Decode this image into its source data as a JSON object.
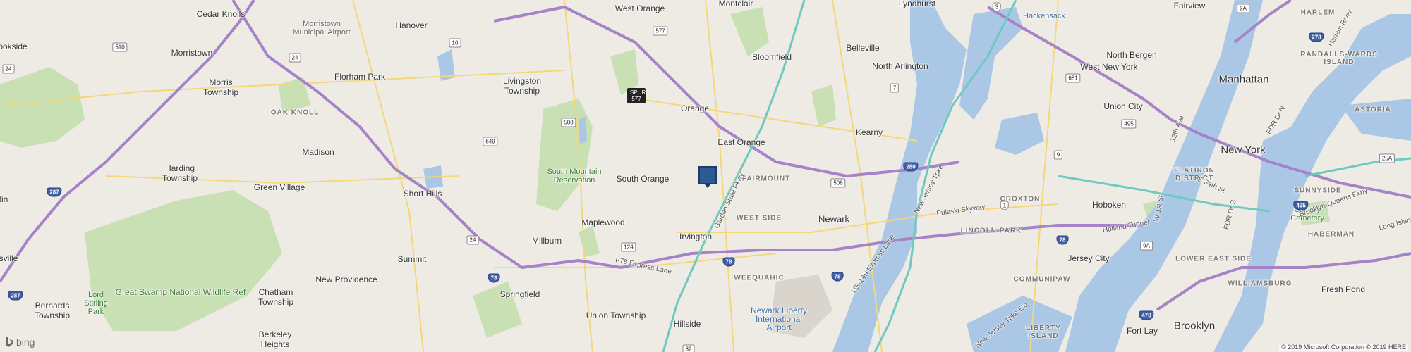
{
  "map": {
    "cities": [
      {
        "name": "West Orange"
      },
      {
        "name": "Montclair"
      },
      {
        "name": "Lyndhurst"
      },
      {
        "name": "Fairview"
      },
      {
        "name": "Cedar Knolls"
      },
      {
        "name": "Hanover"
      },
      {
        "name": "Bloomfield"
      },
      {
        "name": "Belleville"
      },
      {
        "name": "North Arlington"
      },
      {
        "name": "North Bergen"
      },
      {
        "name": "West New York"
      },
      {
        "name": "Morristown"
      },
      {
        "name": "Florham Park"
      },
      {
        "name": "Livingston Township"
      },
      {
        "name": "Morris Township"
      },
      {
        "name": "Orange"
      },
      {
        "name": "Union City"
      },
      {
        "name": "Manhattan"
      },
      {
        "name": "East Orange"
      },
      {
        "name": "Kearny"
      },
      {
        "name": "Madison"
      },
      {
        "name": "Harding Township"
      },
      {
        "name": "South Orange"
      },
      {
        "name": "Green Village"
      },
      {
        "name": "Short Hills"
      },
      {
        "name": "Newark"
      },
      {
        "name": "New York"
      },
      {
        "name": "Hoboken"
      },
      {
        "name": "Maplewood"
      },
      {
        "name": "Irvington"
      },
      {
        "name": "Millburn"
      },
      {
        "name": "Summit"
      },
      {
        "name": "Jersey City"
      },
      {
        "name": "New Providence"
      },
      {
        "name": "Springfield"
      },
      {
        "name": "Chatham Township"
      },
      {
        "name": "Bernards Township"
      },
      {
        "name": "Union Township"
      },
      {
        "name": "Hillside"
      },
      {
        "name": "Berkeley Heights"
      },
      {
        "name": "Fort Lay"
      },
      {
        "name": "Brooklyn"
      },
      {
        "name": "Fresh Pond"
      },
      {
        "name": "ookside"
      },
      {
        "name": "tin"
      },
      {
        "name": "sville"
      }
    ],
    "neighborhoods": [
      {
        "name": "HARLEM"
      },
      {
        "name": "RANDALLS-WARDS ISLAND"
      },
      {
        "name": "OAK KNOLL"
      },
      {
        "name": "ASTORIA"
      },
      {
        "name": "FAIRMOUNT"
      },
      {
        "name": "WEST SIDE"
      },
      {
        "name": "CROXTON"
      },
      {
        "name": "LINCOLN PARK"
      },
      {
        "name": "FLATIRON DISTRICT"
      },
      {
        "name": "SUNNYSIDE"
      },
      {
        "name": "WEEQUAHIC"
      },
      {
        "name": "COMMUNIPAW"
      },
      {
        "name": "HABERMAN"
      },
      {
        "name": "LOWER EAST SIDE"
      },
      {
        "name": "WILLIAMSBURG"
      },
      {
        "name": "LIBERTY ISLAND"
      }
    ],
    "parks": [
      {
        "name": "Morristown Municipal Airport"
      },
      {
        "name": "South Mountain Reservation"
      },
      {
        "name": "Great Swamp National Wildlife Ref"
      },
      {
        "name": "Lord Stirling Park"
      },
      {
        "name": "Calvary Cemetery"
      },
      {
        "name": "Newark Liberty International Airport"
      }
    ],
    "water": [
      {
        "name": "Hackensack"
      }
    ],
    "roads": [
      {
        "name": "Garden State Pkwy"
      },
      {
        "name": "New Jersey Tpke"
      },
      {
        "name": "I-78 Express Lane"
      },
      {
        "name": "US-1&9 Express Lane"
      },
      {
        "name": "Pulaski Skyway"
      },
      {
        "name": "Holland Tunnel"
      },
      {
        "name": "12th Ave"
      },
      {
        "name": "FDR Dr N"
      },
      {
        "name": "E 34th St"
      },
      {
        "name": "FDR Dr S"
      },
      {
        "name": "Brooklyn-Queens Expy"
      },
      {
        "name": "New Jersey Tpke Ext"
      },
      {
        "name": "W 1st St"
      },
      {
        "name": "Long Island"
      },
      {
        "name": "Harlem River"
      }
    ],
    "shields": [
      "3",
      "510",
      "577",
      "10",
      "24",
      "24",
      "SPUR 577",
      "508",
      "7",
      "681",
      "649",
      "280",
      "508",
      "495",
      "9",
      "1",
      "287",
      "287",
      "24",
      "124",
      "78",
      "78",
      "78",
      "78",
      "495",
      "9A",
      "25A",
      "82",
      "478",
      "278",
      "9A"
    ],
    "pin": {
      "label": "Property location"
    },
    "brand": "bing",
    "copyright": "© 2019 Microsoft Corporation © 2019 HERE",
    "colors": {
      "water": "#a9c9e8",
      "park": "#c7dfb2",
      "interstate": "#a682c8",
      "parkway": "#6fc9c0",
      "major": "#f3d77a",
      "pin": "#2d5a92"
    }
  }
}
